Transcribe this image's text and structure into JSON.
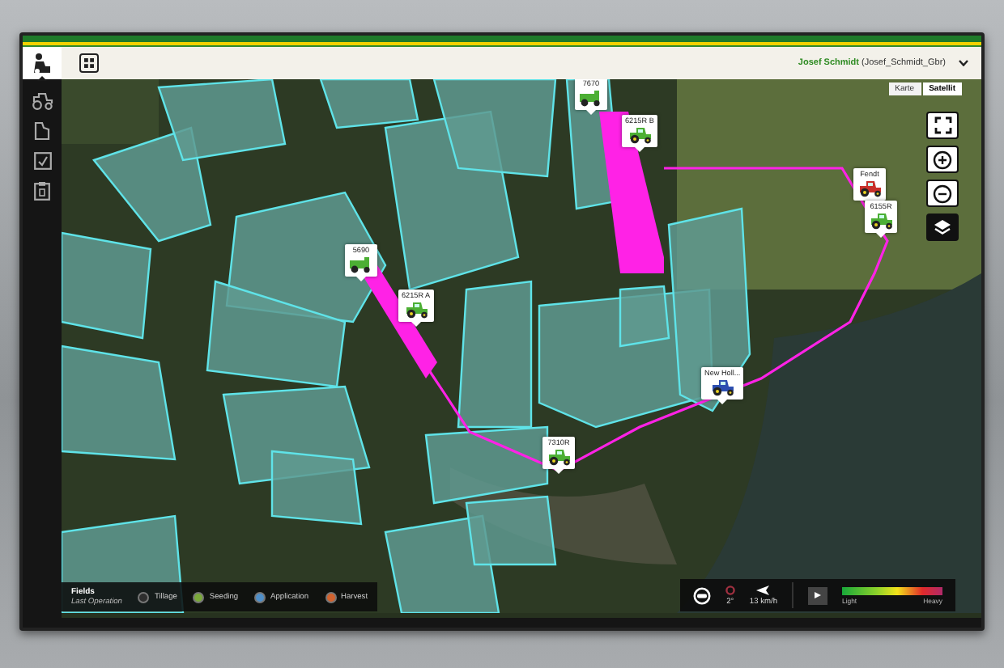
{
  "header": {
    "apps": [
      {
        "kind": "operator",
        "selected": true
      },
      {
        "kind": "grid",
        "selected": false
      }
    ],
    "user_name": "Josef Schmidt",
    "account": "(Josef_Schmidt_Gbr)"
  },
  "sidebar": {
    "items": [
      {
        "kind": "tractor"
      },
      {
        "kind": "field"
      },
      {
        "kind": "task"
      },
      {
        "kind": "clipboard"
      }
    ]
  },
  "map_type": [
    {
      "label": "Karte",
      "selected": false
    },
    {
      "label": "Satellit",
      "selected": true
    }
  ],
  "map_controls": [
    {
      "kind": "fullscreen",
      "selected": false
    },
    {
      "kind": "zoom_in",
      "selected": false
    },
    {
      "kind": "zoom_out",
      "selected": false
    },
    {
      "kind": "layers",
      "selected": true
    }
  ],
  "vehicles": [
    {
      "label": "7670",
      "kind": "combine",
      "color": "#4caf34"
    },
    {
      "label": "6215R B",
      "kind": "tractor",
      "color": "#4caf34"
    },
    {
      "label": "Fendt",
      "kind": "tractor",
      "color": "#c8302a"
    },
    {
      "label": "6155R",
      "kind": "tractor",
      "color": "#4caf34"
    },
    {
      "label": "5690",
      "kind": "combine",
      "color": "#4caf34"
    },
    {
      "label": "6215R A",
      "kind": "tractor",
      "color": "#4caf34"
    },
    {
      "label": "New Holl...",
      "kind": "tractor",
      "color": "#2d4fb0"
    },
    {
      "label": "7310R",
      "kind": "tractor",
      "color": "#4caf34"
    }
  ],
  "legend": {
    "title": "Fields",
    "subtitle": "Last Operation",
    "items": [
      {
        "label": "Tillage",
        "color": "#2e2e2e"
      },
      {
        "label": "Seeding",
        "color": "#7aa83a"
      },
      {
        "label": "Application",
        "color": "#4f8fc9"
      },
      {
        "label": "Harvest",
        "color": "#d2622e"
      }
    ]
  },
  "playback": {
    "heading": "2°",
    "speed": "13 km/h",
    "scale_low": "Light",
    "scale_high": "Heavy"
  }
}
